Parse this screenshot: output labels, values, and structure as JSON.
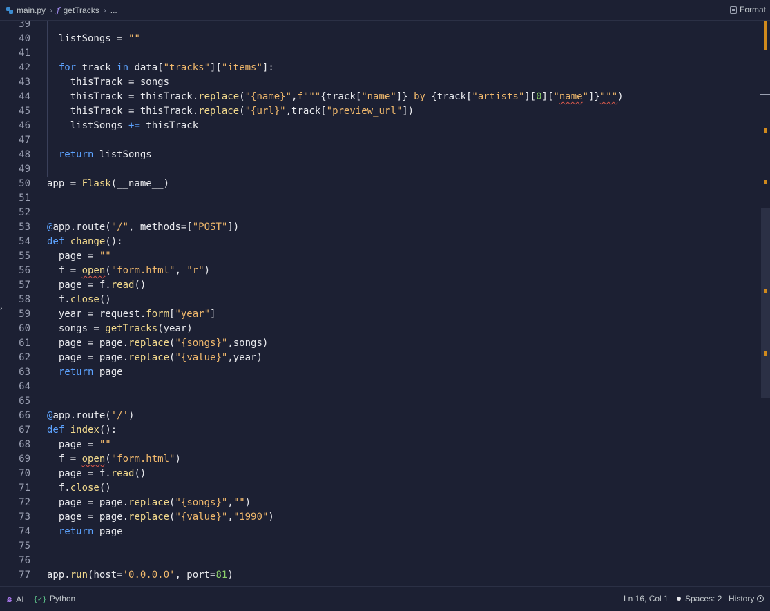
{
  "breadcrumb": {
    "file": "main.py",
    "function": "getTracks",
    "more": "..."
  },
  "toolbar": {
    "format_label": "Format"
  },
  "code_lines": [
    {
      "n": "39",
      "t": []
    },
    {
      "n": "40",
      "t": [
        [
          "txt",
          "  listSongs = "
        ],
        [
          "str",
          "\"\""
        ]
      ]
    },
    {
      "n": "41",
      "t": []
    },
    {
      "n": "42",
      "t": [
        [
          "kw",
          "  for"
        ],
        [
          "txt",
          " track "
        ],
        [
          "kw",
          "in"
        ],
        [
          "txt",
          " data["
        ],
        [
          "str",
          "\"tracks\""
        ],
        [
          "txt",
          "]["
        ],
        [
          "str",
          "\"items\""
        ],
        [
          "txt",
          "]:"
        ]
      ]
    },
    {
      "n": "43",
      "t": [
        [
          "txt",
          "    thisTrack = songs"
        ]
      ]
    },
    {
      "n": "44",
      "t": [
        [
          "txt",
          "    thisTrack = thisTrack."
        ],
        [
          "fn",
          "replace"
        ],
        [
          "txt",
          "("
        ],
        [
          "str",
          "\"{name}\""
        ],
        [
          "txt",
          ","
        ],
        [
          "str",
          "f\"\"\""
        ],
        [
          "txt",
          "{track["
        ],
        [
          "str",
          "\"name\""
        ],
        [
          "txt",
          "]} "
        ],
        [
          "str",
          "by"
        ],
        [
          "txt",
          " {track["
        ],
        [
          "str",
          "\"artists\""
        ],
        [
          "txt",
          "]["
        ],
        [
          "num",
          "0"
        ],
        [
          "txt",
          "]["
        ],
        [
          "str",
          "\""
        ],
        [
          "sq",
          "name"
        ],
        [
          "str",
          "\""
        ],
        [
          "txt",
          "]}"
        ],
        [
          "sq",
          "\"\"\""
        ],
        [
          "txt",
          ")"
        ]
      ]
    },
    {
      "n": "45",
      "t": [
        [
          "txt",
          "    thisTrack = thisTrack."
        ],
        [
          "fn",
          "replace"
        ],
        [
          "txt",
          "("
        ],
        [
          "str",
          "\"{url}\""
        ],
        [
          "txt",
          ",track["
        ],
        [
          "str",
          "\"preview_url\""
        ],
        [
          "txt",
          "])"
        ]
      ]
    },
    {
      "n": "46",
      "t": [
        [
          "txt",
          "    listSongs "
        ],
        [
          "kw",
          "+="
        ],
        [
          "txt",
          " thisTrack"
        ]
      ]
    },
    {
      "n": "47",
      "t": []
    },
    {
      "n": "48",
      "t": [
        [
          "kw",
          "  return"
        ],
        [
          "txt",
          " listSongs"
        ]
      ]
    },
    {
      "n": "49",
      "t": []
    },
    {
      "n": "50",
      "t": [
        [
          "txt",
          "app = "
        ],
        [
          "fn",
          "Flask"
        ],
        [
          "txt",
          "(__name__)"
        ]
      ]
    },
    {
      "n": "51",
      "t": []
    },
    {
      "n": "52",
      "t": []
    },
    {
      "n": "53",
      "t": [
        [
          "dec",
          "@"
        ],
        [
          "txt",
          "app.route("
        ],
        [
          "str",
          "\"/\""
        ],
        [
          "txt",
          ", methods=["
        ],
        [
          "str",
          "\"POST\""
        ],
        [
          "txt",
          "])"
        ]
      ]
    },
    {
      "n": "54",
      "t": [
        [
          "kw",
          "def"
        ],
        [
          "txt",
          " "
        ],
        [
          "fn",
          "change"
        ],
        [
          "txt",
          "():"
        ]
      ]
    },
    {
      "n": "55",
      "t": [
        [
          "txt",
          "  page = "
        ],
        [
          "str",
          "\"\""
        ]
      ]
    },
    {
      "n": "56",
      "t": [
        [
          "txt",
          "  f = "
        ],
        [
          "sqfn",
          "open"
        ],
        [
          "txt",
          "("
        ],
        [
          "str",
          "\"form.html\""
        ],
        [
          "txt",
          ", "
        ],
        [
          "str",
          "\"r\""
        ],
        [
          "txt",
          ")"
        ]
      ]
    },
    {
      "n": "57",
      "t": [
        [
          "txt",
          "  page = f."
        ],
        [
          "fn",
          "read"
        ],
        [
          "txt",
          "()"
        ]
      ]
    },
    {
      "n": "58",
      "t": [
        [
          "txt",
          "  f."
        ],
        [
          "fn",
          "close"
        ],
        [
          "txt",
          "()"
        ]
      ]
    },
    {
      "n": "59",
      "t": [
        [
          "txt",
          "  year = request."
        ],
        [
          "fn",
          "form"
        ],
        [
          "txt",
          "["
        ],
        [
          "str",
          "\"year\""
        ],
        [
          "txt",
          "]"
        ]
      ]
    },
    {
      "n": "60",
      "t": [
        [
          "txt",
          "  songs = "
        ],
        [
          "fn",
          "getTracks"
        ],
        [
          "txt",
          "(year)"
        ]
      ]
    },
    {
      "n": "61",
      "t": [
        [
          "txt",
          "  page = page."
        ],
        [
          "fn",
          "replace"
        ],
        [
          "txt",
          "("
        ],
        [
          "str",
          "\"{songs}\""
        ],
        [
          "txt",
          ",songs)"
        ]
      ]
    },
    {
      "n": "62",
      "t": [
        [
          "txt",
          "  page = page."
        ],
        [
          "fn",
          "replace"
        ],
        [
          "txt",
          "("
        ],
        [
          "str",
          "\"{value}\""
        ],
        [
          "txt",
          ",year)"
        ]
      ]
    },
    {
      "n": "63",
      "t": [
        [
          "kw",
          "  return"
        ],
        [
          "txt",
          " page"
        ]
      ]
    },
    {
      "n": "64",
      "t": []
    },
    {
      "n": "65",
      "t": []
    },
    {
      "n": "66",
      "t": [
        [
          "dec",
          "@"
        ],
        [
          "txt",
          "app.route("
        ],
        [
          "str",
          "'/'"
        ],
        [
          "txt",
          ")"
        ]
      ]
    },
    {
      "n": "67",
      "t": [
        [
          "kw",
          "def"
        ],
        [
          "txt",
          " "
        ],
        [
          "fn",
          "index"
        ],
        [
          "txt",
          "():"
        ]
      ]
    },
    {
      "n": "68",
      "t": [
        [
          "txt",
          "  page = "
        ],
        [
          "str",
          "\"\""
        ]
      ]
    },
    {
      "n": "69",
      "t": [
        [
          "txt",
          "  f = "
        ],
        [
          "sqfn",
          "open"
        ],
        [
          "txt",
          "("
        ],
        [
          "str",
          "\"form.html\""
        ],
        [
          "txt",
          ")"
        ]
      ]
    },
    {
      "n": "70",
      "t": [
        [
          "txt",
          "  page = f."
        ],
        [
          "fn",
          "read"
        ],
        [
          "txt",
          "()"
        ]
      ]
    },
    {
      "n": "71",
      "t": [
        [
          "txt",
          "  f."
        ],
        [
          "fn",
          "close"
        ],
        [
          "txt",
          "()"
        ]
      ]
    },
    {
      "n": "72",
      "t": [
        [
          "txt",
          "  page = page."
        ],
        [
          "fn",
          "replace"
        ],
        [
          "txt",
          "("
        ],
        [
          "str",
          "\"{songs}\""
        ],
        [
          "txt",
          ","
        ],
        [
          "str",
          "\"\""
        ],
        [
          "txt",
          ")"
        ]
      ]
    },
    {
      "n": "73",
      "t": [
        [
          "txt",
          "  page = page."
        ],
        [
          "fn",
          "replace"
        ],
        [
          "txt",
          "("
        ],
        [
          "str",
          "\"{value}\""
        ],
        [
          "txt",
          ","
        ],
        [
          "str",
          "\"1990\""
        ],
        [
          "txt",
          ")"
        ]
      ]
    },
    {
      "n": "74",
      "t": [
        [
          "kw",
          "  return"
        ],
        [
          "txt",
          " page"
        ]
      ]
    },
    {
      "n": "75",
      "t": []
    },
    {
      "n": "76",
      "t": []
    },
    {
      "n": "77",
      "t": [
        [
          "txt",
          "app."
        ],
        [
          "fn",
          "run"
        ],
        [
          "txt",
          "(host="
        ],
        [
          "str",
          "'0.0.0.0'"
        ],
        [
          "txt",
          ", port="
        ],
        [
          "num",
          "81"
        ],
        [
          "txt",
          ")"
        ]
      ]
    }
  ],
  "status": {
    "ai_label": "AI",
    "language": "Python",
    "cursor": "Ln 16, Col 1",
    "spaces": "Spaces: 2",
    "history": "History"
  },
  "colors": {
    "background": "#1c2033",
    "keyword": "#5da3ff",
    "string": "#f0b86c",
    "function": "#f2d98c",
    "number": "#8dd16b",
    "marker": "#d08a1d"
  }
}
